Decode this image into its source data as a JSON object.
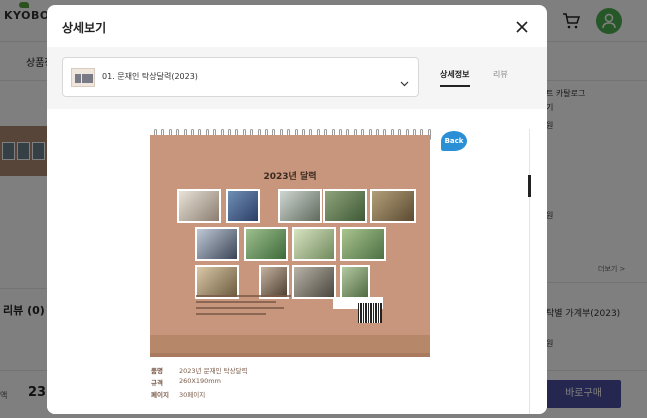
{
  "background": {
    "logo": "KYOBO",
    "tab_label": "상품정",
    "review_label": "리뷰 (0)",
    "amount_label": "액",
    "amount_value": "23,",
    "right_texts": [
      "트 카탈로그",
      "기",
      "원",
      "원",
      "더보기 >",
      "탁별 가계부(2023)",
      "원"
    ],
    "buy_button": "바로구매"
  },
  "modal": {
    "title": "상세보기",
    "select_value": "01. 문재인 탁상달력(2023)",
    "tabs": [
      {
        "label": "상세정보",
        "active": true
      },
      {
        "label": "리뷰",
        "active": false
      }
    ],
    "product_image": {
      "calendar_title": "2023년 달력",
      "badge": "Back"
    },
    "specs": [
      {
        "key": "품명",
        "value": "2023년 문재인 탁상달력"
      },
      {
        "key": "규격",
        "value": "260X190mm"
      },
      {
        "key": "페이지",
        "value": "30페이지"
      }
    ]
  },
  "colors": {
    "accent": "#4a4fa3",
    "calendar": "#c8967c",
    "badge": "#2b8fd6",
    "avatar": "#4caf50"
  }
}
